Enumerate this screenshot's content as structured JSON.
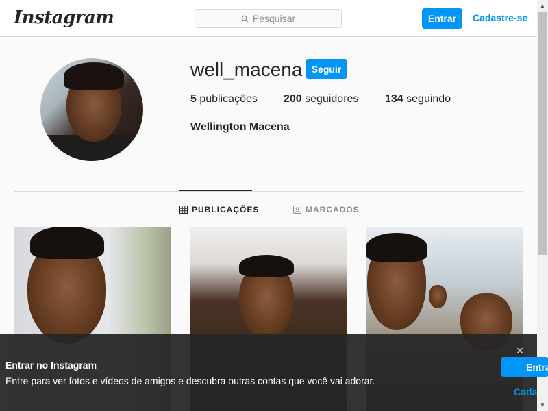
{
  "header": {
    "logo_text": "Instagram",
    "search_placeholder": "Pesquisar",
    "login_label": "Entrar",
    "signup_label": "Cadastre-se"
  },
  "profile": {
    "username": "well_macena",
    "follow_label": "Seguir",
    "posts_count": "5",
    "posts_label": "publicações",
    "followers_count": "200",
    "followers_label": "seguidores",
    "following_count": "134",
    "following_label": "seguindo",
    "full_name": "Wellington Macena"
  },
  "tabs": [
    {
      "label": "PUBLICAÇÕES",
      "icon": "grid-icon",
      "active": true
    },
    {
      "label": "MARCADOS",
      "icon": "tagged-icon",
      "active": false
    }
  ],
  "posts": [
    {
      "icon": "photo-selfie"
    },
    {
      "icon": "photo-selfie"
    },
    {
      "icon": "photo-group"
    }
  ],
  "login_banner": {
    "title": "Entrar no Instagram",
    "text": "Entre para ver fotos e vídeos de amigos e descubra outras contas que você vai adorar.",
    "login_label": "Entrar",
    "signup_label": "Cadastre-se",
    "close_icon": "close-icon"
  },
  "colors": {
    "accent": "#0095f6",
    "text": "#262626",
    "muted": "#8e8e8e",
    "border": "#dbdbdb",
    "background": "#fafafa"
  }
}
